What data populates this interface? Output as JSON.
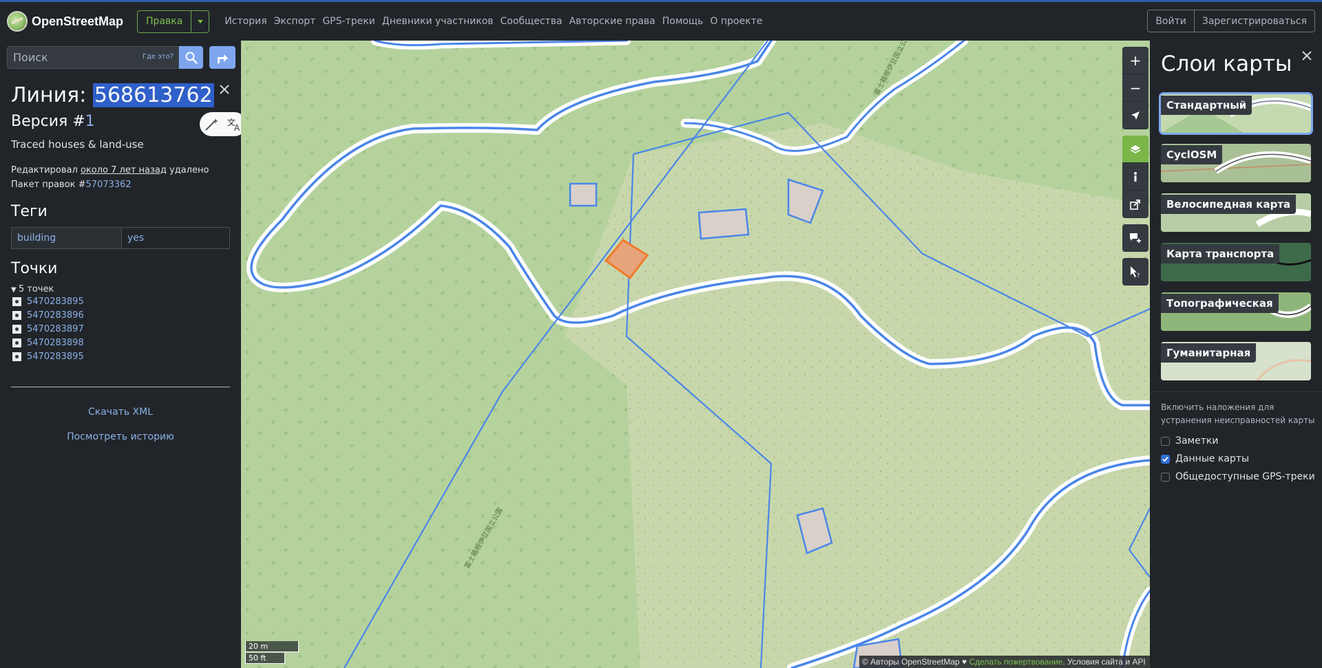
{
  "header": {
    "logo_text": "OpenStreetMap",
    "edit_label": "Правка",
    "nav": [
      "История",
      "Экспорт",
      "GPS-треки",
      "Дневники участников",
      "Сообщества",
      "Авторские права",
      "Помощь",
      "О проекте"
    ],
    "login": "Войти",
    "signup": "Зарегистрироваться"
  },
  "search": {
    "placeholder": "Поиск",
    "where_is": "Где это?"
  },
  "way": {
    "title_prefix": "Линия:",
    "id": "568613762",
    "version_prefix": "Версия #",
    "version": "1",
    "comment": "Traced houses & land-use",
    "edited_by": "Редактировал",
    "edited_when": "около 7 лет назад",
    "edited_status": "удалено",
    "changeset_prefix": "Пакет правок #",
    "changeset": "57073362"
  },
  "tags": {
    "heading": "Теги",
    "items": [
      {
        "key": "building",
        "value": "yes"
      }
    ]
  },
  "nodes": {
    "heading": "Точки",
    "summary": "5 точек",
    "items": [
      "5470283895",
      "5470283896",
      "5470283897",
      "5470283898",
      "5470283895"
    ]
  },
  "links": {
    "download_xml": "Скачать XML",
    "view_history": "Посмотреть историю"
  },
  "map": {
    "scale_metric": "20 m",
    "scale_imperial": "50 ft",
    "attribution_prefix": "© Авторы OpenStreetMap ♥ ",
    "attribution_donate": "Сделать пожертвование",
    "attribution_suffix": ". Условия сайта и API",
    "road_label": "富士箱根伊豆国立公園"
  },
  "layers_panel": {
    "title": "Слои карты",
    "layers": [
      "Стандартный",
      "CyclOSM",
      "Велосипедная карта",
      "Карта транспорта",
      "Топографическая",
      "Гуманитарная"
    ],
    "overlay_caption": "Включить наложения для устранения неисправностей карты",
    "overlays": [
      {
        "label": "Заметки",
        "checked": false
      },
      {
        "label": "Данные карты",
        "checked": true
      },
      {
        "label": "Общедоступные GPS-треки",
        "checked": false
      }
    ]
  },
  "colors": {
    "accent": "#7ea6ef",
    "edit_green": "#7cc04f",
    "selected_way": "#f08a3c",
    "data_lines": "#4a86e8",
    "forest": "#b5d29d",
    "scrub": "#c8d7ab"
  }
}
